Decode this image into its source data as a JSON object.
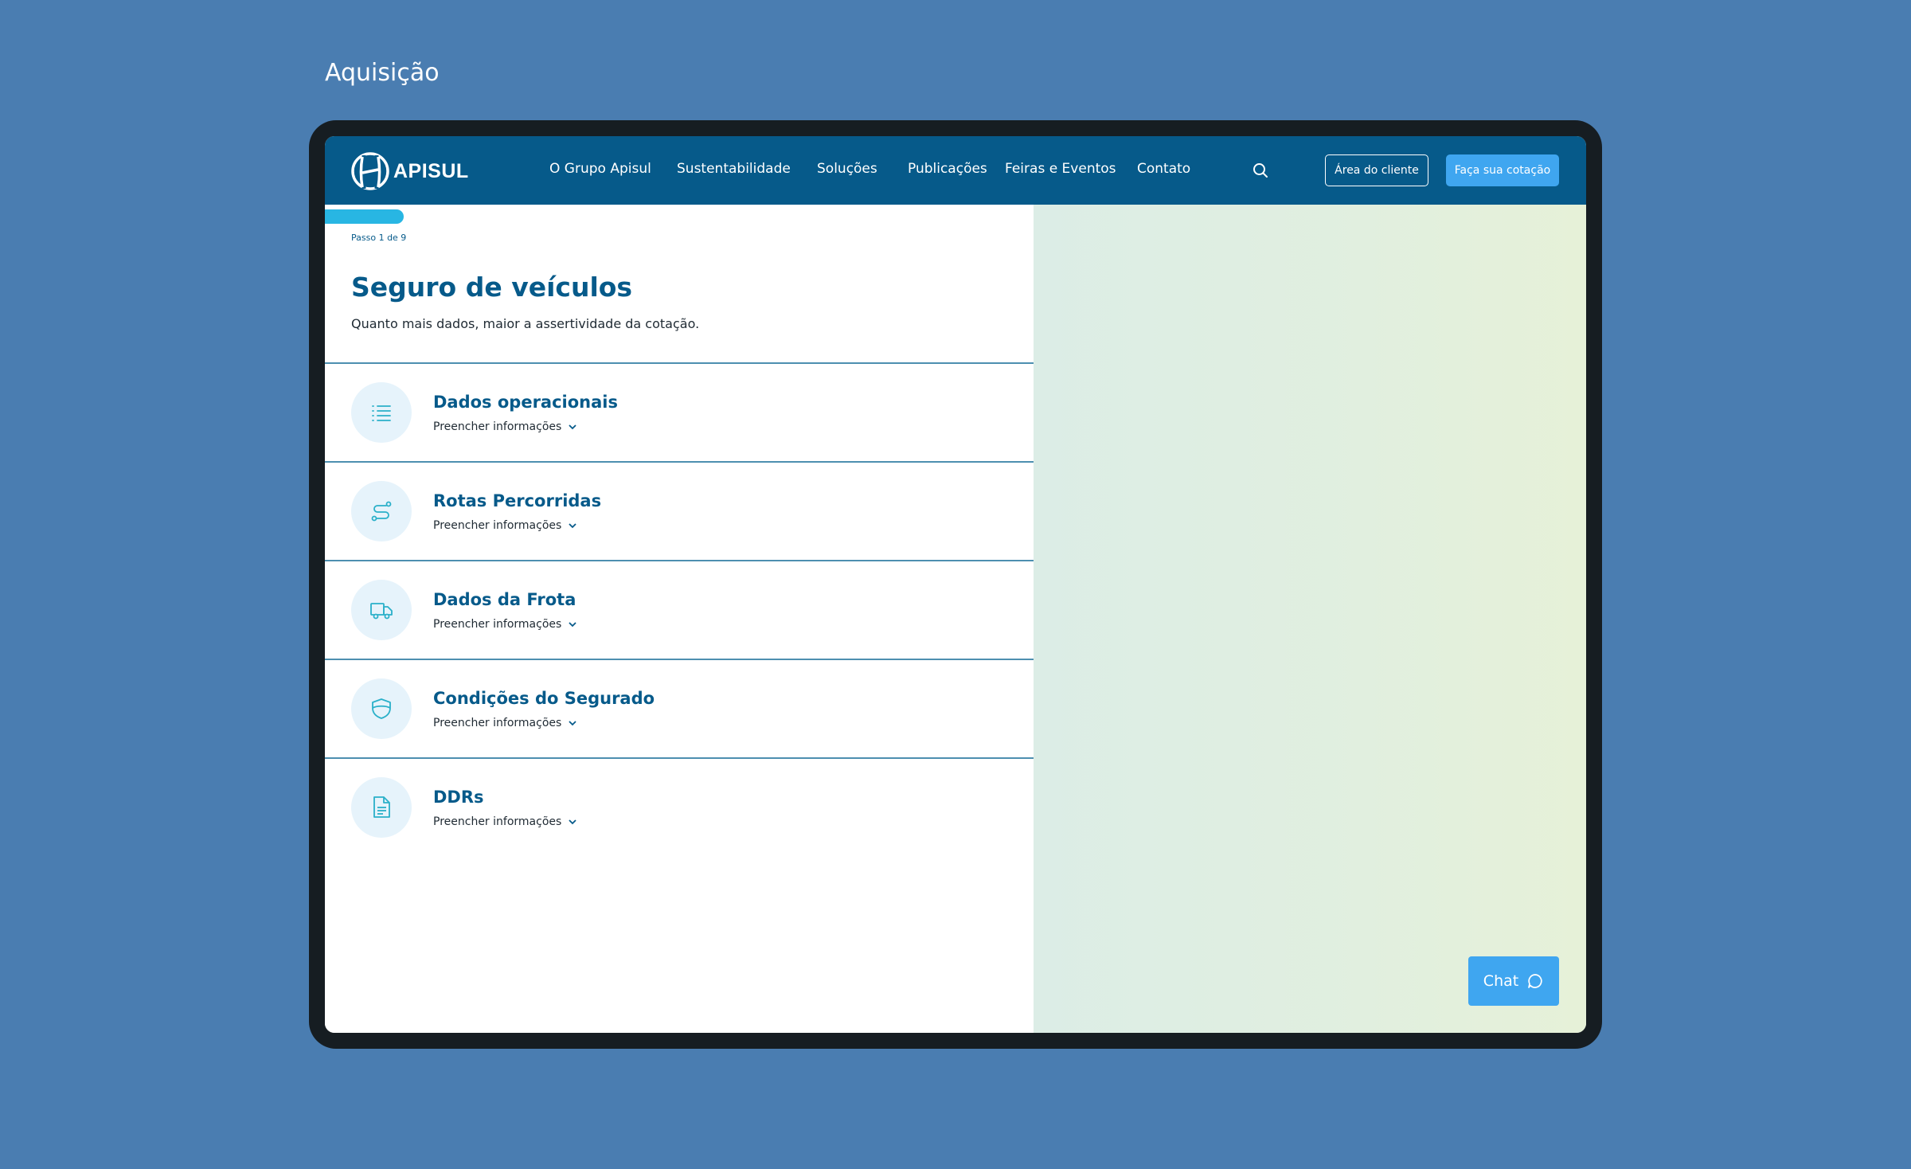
{
  "page_caption": "Aquisição",
  "header": {
    "logo_text": "APISUL",
    "nav": [
      "O Grupo Apisul",
      "Sustentabilidade",
      "Soluções",
      "Publicações",
      "Feiras e Eventos",
      "Contato"
    ],
    "client_area_label": "Área do cliente",
    "quote_label": "Faça sua cotação"
  },
  "form": {
    "progress_fraction": 0.111,
    "step_label": "Passo 1 de 9",
    "title": "Seguro de veículos",
    "subtitle": "Quanto mais dados, maior a assertividade da cotação.",
    "sections": [
      {
        "title": "Dados operacionais",
        "action": "Preencher informações",
        "icon": "list-icon"
      },
      {
        "title": "Rotas Percorridas",
        "action": "Preencher informações",
        "icon": "route-icon"
      },
      {
        "title": "Dados da Frota",
        "action": "Preencher informações",
        "icon": "truck-icon"
      },
      {
        "title": "Condições do Segurado",
        "action": "Preencher informações",
        "icon": "shield-icon"
      },
      {
        "title": "DDRs",
        "action": "Preencher informações",
        "icon": "document-icon"
      }
    ]
  },
  "chat": {
    "label": "Chat"
  },
  "colors": {
    "background": "#4a7db1",
    "nav": "#065a8a",
    "accent": "#3fa6f0",
    "progress": "#28b6e3",
    "icon": "#2ab0c9"
  }
}
